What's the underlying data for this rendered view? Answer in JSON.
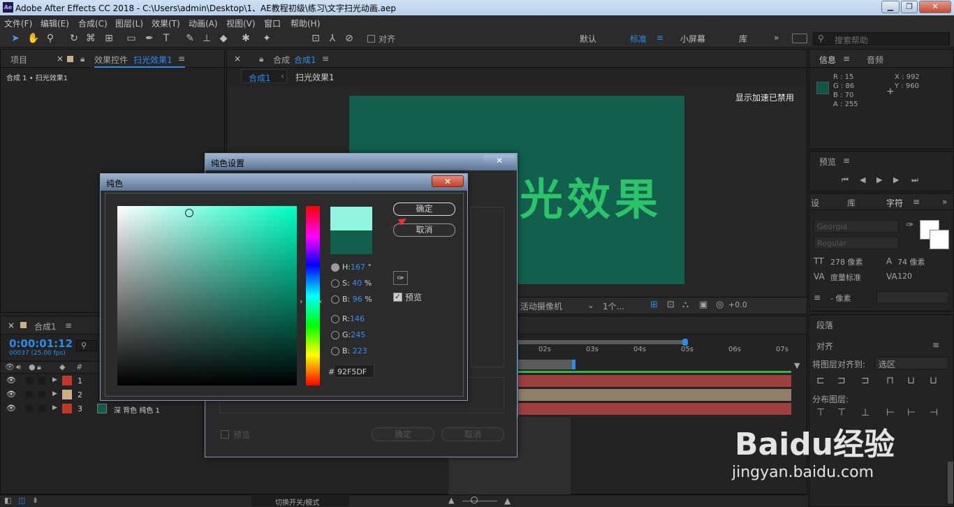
{
  "window": {
    "title": "Adobe After Effects CC 2018 - C:\\Users\\admin\\Desktop\\1、AE教程初级\\练习\\文字扫光动画.aep",
    "logo": "Ae"
  },
  "menu": [
    "文件(F)",
    "编辑(E)",
    "合成(C)",
    "图层(L)",
    "效果(T)",
    "动画(A)",
    "视图(V)",
    "窗口",
    "帮助(H)"
  ],
  "toolbar": {
    "align_label": "对齐",
    "workspaces": [
      "默认",
      "标准",
      "小屏幕",
      "库"
    ],
    "search_placeholder": "搜索帮助"
  },
  "project_panel": {
    "tab_project": "项目",
    "tab_effects": "效果控件",
    "effects_target": "扫光效果1",
    "breadcrumb": "合成 1 • 扫光效果1"
  },
  "comp_panel": {
    "tab": "合成",
    "tab_name": "合成1",
    "crumb1": "合成1",
    "crumb2": "扫光效果1",
    "gpu_note": "显示加速已禁用",
    "comp_text": "光效果",
    "camera": "活动摄像机",
    "views": "1个...",
    "exposure": "+0.0"
  },
  "info_panel": {
    "tab_info": "信息",
    "tab_audio": "音频",
    "r": "R : 15",
    "g": "G : 86",
    "b": "B : 70",
    "a": "A : 255",
    "x": "X : 992",
    "y": "Y : 960"
  },
  "preview_panel": {
    "tab": "预览"
  },
  "character_panel": {
    "tab1": "设",
    "tab2": "库",
    "tab3": "字符",
    "font": "Georgia",
    "style": "Regular",
    "size": "278 像素",
    "leading": "74 像素",
    "kerning": "度量标准",
    "tracking": "120",
    "stroke": "- 像素"
  },
  "paragraph_panel": {
    "tab": "段落"
  },
  "align_panel": {
    "tab": "对齐",
    "align_to_label": "将图层对齐到:",
    "align_to_value": "选区",
    "distribute_label": "分布图层:"
  },
  "timeline": {
    "tab": "合成1",
    "timecode": "0:00:01:12",
    "frames": "00037 (25.00 fps)",
    "col_num": "#",
    "rulers": [
      "02s",
      "03s",
      "04s",
      "05s",
      "06s",
      "07s"
    ],
    "layers": [
      {
        "num": "1",
        "name": "",
        "color": "#c0392b"
      },
      {
        "num": "2",
        "name": "",
        "color": "#c9b08a"
      },
      {
        "num": "3",
        "name": "深 背色 纯色 1",
        "color": "#c0392b"
      }
    ],
    "toggle_label": "切换开关/模式"
  },
  "solid_settings_dialog": {
    "title": "纯色设置",
    "preview_label": "预览",
    "ok": "确定",
    "cancel": "取消"
  },
  "color_dialog": {
    "title": "纯色",
    "ok": "确定",
    "cancel": "取消",
    "h": "167",
    "h_unit": "°",
    "s": "40",
    "s_unit": "%",
    "b": "96",
    "b_unit": "%",
    "r": "146",
    "g": "245",
    "bb": "223",
    "hex": "92F5DF",
    "preview_label": "预览",
    "new_color": "#92f5df",
    "old_color": "#125f4e",
    "labels": {
      "h": "H:",
      "s": "S:",
      "b": "B:",
      "r": "R:",
      "g": "G:",
      "bb": "B:",
      "hash": "#"
    }
  },
  "watermark": {
    "brand": "Baidu经验",
    "url": "jingyan.baidu.com"
  },
  "colors": {
    "accent": "#2d8ceb",
    "comp_bg": "#125f4e",
    "comp_text": "#2cc36b"
  }
}
